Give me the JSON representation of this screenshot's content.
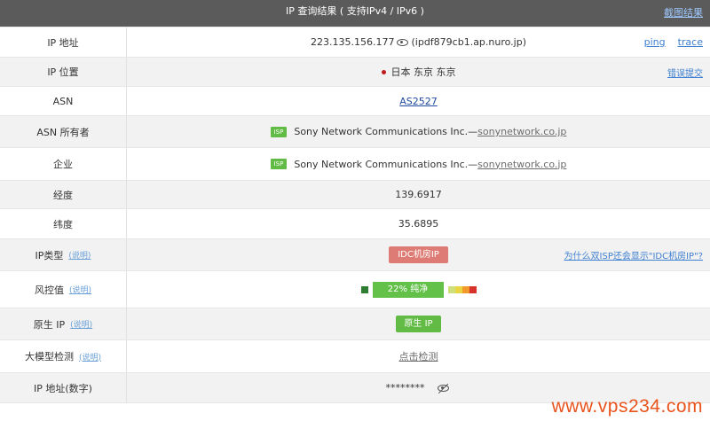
{
  "header": {
    "title": "IP 查询结果 ( 支持IPv4 / IPv6 )",
    "screenshot_link": "截图结果"
  },
  "rows": {
    "ip_address": {
      "label": "IP 地址",
      "ip": "223.135.156.177",
      "hostname": "(ipdf879cb1.ap.nuro.jp)",
      "ping": "ping",
      "trace": "trace"
    },
    "ip_location": {
      "label": "IP 位置",
      "location": "日本 东京 东京",
      "report": "错误提交"
    },
    "asn": {
      "label": "ASN",
      "value": "AS2527"
    },
    "asn_owner": {
      "label": "ASN 所有者",
      "badge": "ISP",
      "name": "Sony Network Communications Inc.—",
      "domain": "sonynetwork.co.jp"
    },
    "company": {
      "label": "企业",
      "badge": "ISP",
      "name": "Sony Network Communications Inc.—",
      "domain": "sonynetwork.co.jp"
    },
    "longitude": {
      "label": "经度",
      "value": "139.6917"
    },
    "latitude": {
      "label": "纬度",
      "value": "35.6895"
    },
    "ip_type": {
      "label": "IP类型",
      "hint": "(说明)",
      "value": "IDC机房IP",
      "question": "为什么双ISP还会显示\"IDC机房IP\"?"
    },
    "risk": {
      "label": "风控值",
      "hint": "(说明)",
      "value": "22%   纯净",
      "percent": 22,
      "scale_colors": [
        "#cfe07a",
        "#e9d442",
        "#f19a2b",
        "#d6322b"
      ],
      "low_color": "#2f7d30"
    },
    "native_ip": {
      "label": "原生 IP",
      "hint": "(说明)",
      "value": "原生 IP"
    },
    "llm_check": {
      "label": "大模型检测",
      "hint": "(说明)",
      "value": "点击检测"
    },
    "ip_numeric": {
      "label": "IP 地址(数字)",
      "value": "********"
    }
  },
  "watermark": "www.vps234.com"
}
